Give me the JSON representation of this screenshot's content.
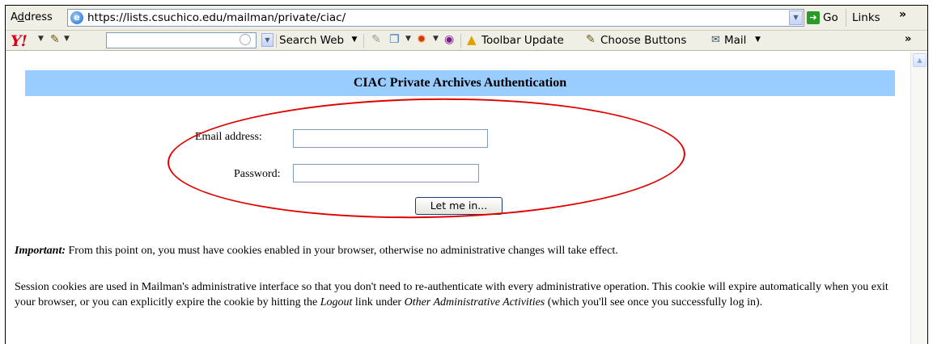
{
  "address_bar": {
    "label_underlined": "d",
    "label_prefix": "A",
    "label_suffix": "dress",
    "url": "https://lists.csuchico.edu/mailman/private/ciac/",
    "go_label": "Go",
    "links_label": "Links",
    "overflow": "»"
  },
  "toolbar": {
    "yahoo_logo": "Y!",
    "search_web_label": "Search Web",
    "toolbar_update_label": "Toolbar Update",
    "choose_buttons_label": "Choose Buttons",
    "mail_label": "Mail",
    "overflow": "»"
  },
  "page": {
    "title": "CIAC Private Archives Authentication",
    "email_label": "Email address:",
    "password_label": "Password:",
    "submit_label": "Let me in...",
    "important_lead": "Important:",
    "important_text": " From this point on, you must have cookies enabled in your browser, otherwise no administrative changes will take effect.",
    "session_text_1": "Session cookies are used in Mailman's administrative interface so that you don't need to re-authenticate with every administrative operation. This cookie will expire automatically when you exit your browser, or you can explicitly expire the cookie by hitting the ",
    "logout_link": "Logout",
    "session_text_2": " link under ",
    "other_activities": "Other Administrative Activities",
    "session_text_3": " (which you'll see once you successfully log in)."
  },
  "colors": {
    "banner": "#99ccff",
    "annotation_ellipse": "#e00000"
  }
}
